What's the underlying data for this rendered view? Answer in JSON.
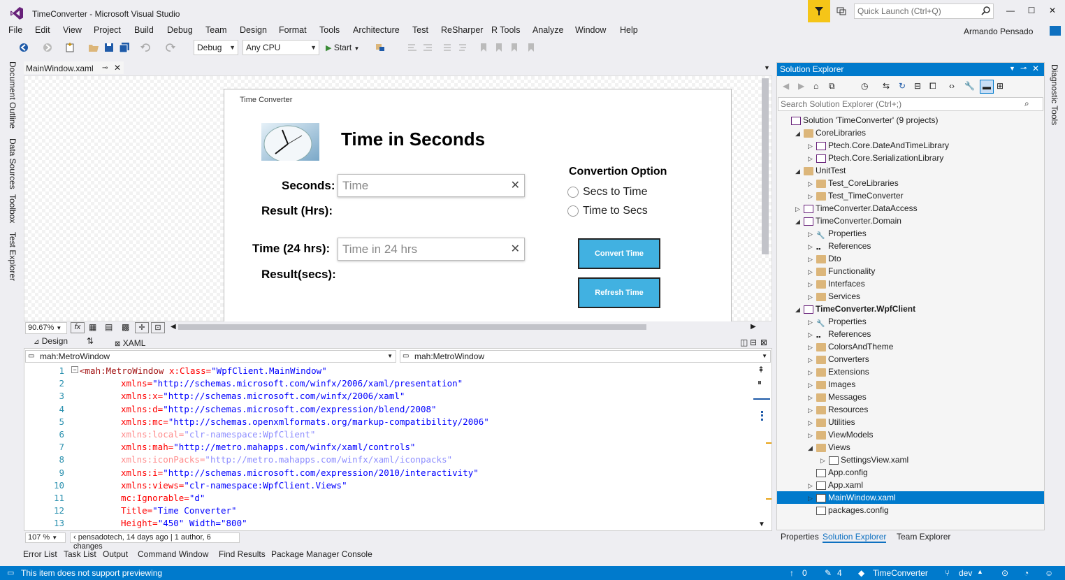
{
  "window": {
    "title": "TimeConverter - Microsoft Visual Studio",
    "quick_launch_placeholder": "Quick Launch (Ctrl+Q)",
    "user": "Armando Pensado"
  },
  "menu": [
    "File",
    "Edit",
    "View",
    "Project",
    "Build",
    "Debug",
    "Team",
    "Design",
    "Format",
    "Tools",
    "Architecture",
    "Test",
    "ReSharper",
    "R Tools",
    "Analyze",
    "Window",
    "Help"
  ],
  "toolbar": {
    "config": "Debug",
    "platform": "Any CPU",
    "start_label": "Start"
  },
  "left_tabs": [
    "Document Outline",
    "Data Sources",
    "Toolbox",
    "Test Explorer"
  ],
  "right_tabs": [
    "Diagnostic Tools"
  ],
  "document_tab": {
    "label": "MainWindow.xaml"
  },
  "designer": {
    "window_title": "Time Converter",
    "heading": "Time in Seconds",
    "seconds_label": "Seconds:",
    "seconds_placeholder": "Time",
    "result_hrs_label": "Result (Hrs):",
    "time24_label": "Time (24 hrs):",
    "time24_placeholder": "Time in 24 hrs",
    "result_secs_label": "Result(secs):",
    "option_title": "Convertion Option",
    "option_1": "Secs to Time",
    "option_2": "Time to Secs",
    "convert_button": "Convert Time",
    "refresh_button": "Refresh Time",
    "zoom": "90.67%"
  },
  "view_tabs": {
    "design": "Design",
    "xaml": "XAML"
  },
  "nav": {
    "left": "mah:MetroWindow",
    "right": "mah:MetroWindow"
  },
  "code_lines": [
    {
      "n": "1",
      "tag": "<mah:MetroWindow",
      "attr": " x:Class=",
      "val": "\"WpfClient.MainWindow\"",
      "dim": false,
      "indent": false
    },
    {
      "n": "2",
      "tag": "",
      "attr": "xmlns=",
      "val": "\"http://schemas.microsoft.com/winfx/2006/xaml/presentation\"",
      "dim": false,
      "indent": true
    },
    {
      "n": "3",
      "tag": "",
      "attr": "xmlns:x=",
      "val": "\"http://schemas.microsoft.com/winfx/2006/xaml\"",
      "dim": false,
      "indent": true
    },
    {
      "n": "4",
      "tag": "",
      "attr": "xmlns:d=",
      "val": "\"http://schemas.microsoft.com/expression/blend/2008\"",
      "dim": false,
      "indent": true
    },
    {
      "n": "5",
      "tag": "",
      "attr": "xmlns:mc=",
      "val": "\"http://schemas.openxmlformats.org/markup-compatibility/2006\"",
      "dim": false,
      "indent": true
    },
    {
      "n": "6",
      "tag": "",
      "attr": "xmlns:local=",
      "val": "\"clr-namespace:WpfClient\"",
      "dim": true,
      "indent": true
    },
    {
      "n": "7",
      "tag": "",
      "attr": "xmlns:mah=",
      "val": "\"http://metro.mahapps.com/winfx/xaml/controls\"",
      "dim": false,
      "indent": true
    },
    {
      "n": "8",
      "tag": "",
      "attr": "xmlns:iconPacks=",
      "val": "\"http://metro.mahapps.com/winfx/xaml/iconpacks\"",
      "dim": true,
      "indent": true
    },
    {
      "n": "9",
      "tag": "",
      "attr": "xmlns:i=",
      "val": "\"http://schemas.microsoft.com/expression/2010/interactivity\"",
      "dim": false,
      "indent": true
    },
    {
      "n": "10",
      "tag": "",
      "attr": "xmlns:views=",
      "val": "\"clr-namespace:WpfClient.Views\"",
      "dim": false,
      "indent": true
    },
    {
      "n": "11",
      "tag": "",
      "attr": "mc:Ignorable=",
      "val": "\"d\"",
      "dim": false,
      "indent": true
    },
    {
      "n": "12",
      "tag": "",
      "attr": "Title=",
      "val": "\"Time Converter\"",
      "dim": false,
      "indent": true
    },
    {
      "n": "13",
      "tag": "",
      "attr": "Height=",
      "val": "\"450\" Width=\"800\"",
      "dim": false,
      "indent": true
    }
  ],
  "editor_status": {
    "zoom": "107 %",
    "codelens": "pensadotech, 14 days ago | 1 author, 6 changes"
  },
  "bottom_tabs": [
    "Error List",
    "Task List",
    "Output",
    "Command Window",
    "Find Results",
    "Package Manager Console"
  ],
  "statusbar": {
    "message": "This item does not support previewing",
    "up_count": "0",
    "edit_count": "4",
    "repo": "TimeConverter",
    "branch": "dev"
  },
  "solution_explorer": {
    "title": "Solution Explorer",
    "search_placeholder": "Search Solution Explorer (Ctrl+;)",
    "tree": [
      {
        "label": "Solution 'TimeConverter' (9 projects)",
        "level": 0,
        "icon": "solution",
        "exp": "",
        "bold": false,
        "selected": false
      },
      {
        "label": "CoreLibraries",
        "level": 1,
        "icon": "folder",
        "exp": "◢",
        "bold": false,
        "selected": false
      },
      {
        "label": "Ptech.Core.DateAndTimeLibrary",
        "level": 2,
        "icon": "proj",
        "exp": "▷",
        "bold": false,
        "selected": false
      },
      {
        "label": "Ptech.Core.SerializationLibrary",
        "level": 2,
        "icon": "proj",
        "exp": "▷",
        "bold": false,
        "selected": false
      },
      {
        "label": "UnitTest",
        "level": 1,
        "icon": "folder",
        "exp": "◢",
        "bold": false,
        "selected": false
      },
      {
        "label": "Test_CoreLibraries",
        "level": 2,
        "icon": "folder",
        "exp": "▷",
        "bold": false,
        "selected": false
      },
      {
        "label": "Test_TimeConverter",
        "level": 2,
        "icon": "folder",
        "exp": "▷",
        "bold": false,
        "selected": false
      },
      {
        "label": "TimeConverter.DataAccess",
        "level": 1,
        "icon": "proj",
        "exp": "▷",
        "bold": false,
        "selected": false
      },
      {
        "label": "TimeConverter.Domain",
        "level": 1,
        "icon": "proj",
        "exp": "◢",
        "bold": false,
        "selected": false
      },
      {
        "label": "Properties",
        "level": 2,
        "icon": "wrench",
        "exp": "▷",
        "bold": false,
        "selected": false
      },
      {
        "label": "References",
        "level": 2,
        "icon": "refs",
        "exp": "▷",
        "bold": false,
        "selected": false
      },
      {
        "label": "Dto",
        "level": 2,
        "icon": "folder",
        "exp": "▷",
        "bold": false,
        "selected": false
      },
      {
        "label": "Functionality",
        "level": 2,
        "icon": "folder",
        "exp": "▷",
        "bold": false,
        "selected": false
      },
      {
        "label": "Interfaces",
        "level": 2,
        "icon": "folder",
        "exp": "▷",
        "bold": false,
        "selected": false
      },
      {
        "label": "Services",
        "level": 2,
        "icon": "folder",
        "exp": "▷",
        "bold": false,
        "selected": false
      },
      {
        "label": "TimeConverter.WpfClient",
        "level": 1,
        "icon": "proj",
        "exp": "◢",
        "bold": true,
        "selected": false
      },
      {
        "label": "Properties",
        "level": 2,
        "icon": "wrench",
        "exp": "▷",
        "bold": false,
        "selected": false
      },
      {
        "label": "References",
        "level": 2,
        "icon": "refs",
        "exp": "▷",
        "bold": false,
        "selected": false
      },
      {
        "label": "ColorsAndTheme",
        "level": 2,
        "icon": "folder",
        "exp": "▷",
        "bold": false,
        "selected": false
      },
      {
        "label": "Converters",
        "level": 2,
        "icon": "folder",
        "exp": "▷",
        "bold": false,
        "selected": false
      },
      {
        "label": "Extensions",
        "level": 2,
        "icon": "folder",
        "exp": "▷",
        "bold": false,
        "selected": false
      },
      {
        "label": "Images",
        "level": 2,
        "icon": "folder",
        "exp": "▷",
        "bold": false,
        "selected": false
      },
      {
        "label": "Messages",
        "level": 2,
        "icon": "folder",
        "exp": "▷",
        "bold": false,
        "selected": false
      },
      {
        "label": "Resources",
        "level": 2,
        "icon": "folder",
        "exp": "▷",
        "bold": false,
        "selected": false
      },
      {
        "label": "Utilities",
        "level": 2,
        "icon": "folder",
        "exp": "▷",
        "bold": false,
        "selected": false
      },
      {
        "label": "ViewModels",
        "level": 2,
        "icon": "folder",
        "exp": "▷",
        "bold": false,
        "selected": false
      },
      {
        "label": "Views",
        "level": 2,
        "icon": "folder",
        "exp": "◢",
        "bold": false,
        "selected": false
      },
      {
        "label": "SettingsView.xaml",
        "level": 3,
        "icon": "file",
        "exp": "▷",
        "bold": false,
        "selected": false
      },
      {
        "label": "App.config",
        "level": 2,
        "icon": "file",
        "exp": "",
        "bold": false,
        "selected": false
      },
      {
        "label": "App.xaml",
        "level": 2,
        "icon": "file",
        "exp": "▷",
        "bold": false,
        "selected": false
      },
      {
        "label": "MainWindow.xaml",
        "level": 2,
        "icon": "file",
        "exp": "▷",
        "bold": false,
        "selected": true
      },
      {
        "label": "packages.config",
        "level": 2,
        "icon": "file",
        "exp": "",
        "bold": false,
        "selected": false
      }
    ],
    "bottom_tabs": [
      "Properties",
      "Solution Explorer",
      "Team Explorer"
    ]
  },
  "colors": {
    "accent": "#007acc",
    "button": "#41b1e1",
    "flag": "#f5c518"
  }
}
